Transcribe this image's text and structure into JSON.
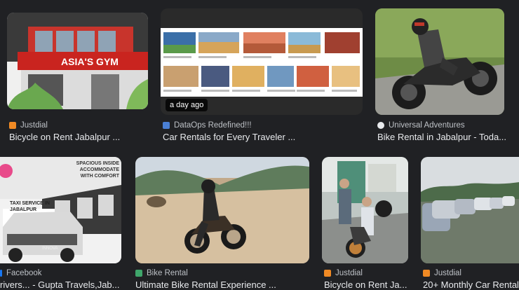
{
  "results": [
    {
      "source": "Justdial",
      "title": "Bicycle on Rent Jabalpur ...",
      "sign": "ASIA'S GYM"
    },
    {
      "source": "DataOps Redefined!!!",
      "title": "Car Rentals for Every Traveler ...",
      "badge": "a day ago"
    },
    {
      "source": "Universal Adventures",
      "title": "Bike Rental in Jabalpur - Toda..."
    },
    {
      "source": "Facebook",
      "title": "rivers... - Gupta Travels,Jab...",
      "ad_headline": "SPACIOUS INSIDE ACCOMMODATE WITH COMFORT",
      "ad_sub": "TAXI SERVICE IN JABALPUR",
      "ad_car": "INNOVA"
    },
    {
      "source": "Bike Rental",
      "title": "Ultimate Bike Rental Experience ..."
    },
    {
      "source": "Justdial",
      "title": "Bicycle on Rent Ja..."
    },
    {
      "source": "Justdial",
      "title": "20+ Monthly Car Rental..."
    }
  ],
  "colors": {
    "justdial": "#f08a24",
    "dataops": "#4a7fd4",
    "universal": "#e8eaed",
    "facebook": "#1877f2",
    "bikerental": "#3fa66b"
  }
}
